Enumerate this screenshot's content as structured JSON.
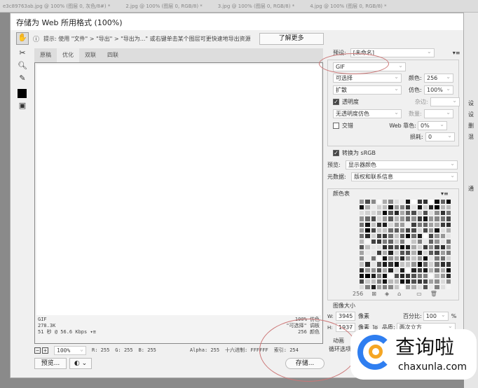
{
  "doc_tabs": [
    "e3c89763ab.jpg @ 100% (图层 0, 灰色/8#) *",
    "2.jpg @ 100% (图层 0, RGB/8) *",
    "3.jpg @ 100% (图层 0, RGB/8) *",
    "4.jpg @ 100% (图层 0, RGB/8) *"
  ],
  "right_bg": [
    "设",
    "设",
    "删",
    "混",
    "通"
  ],
  "dialog": {
    "title": "存储为 Web 所用格式 (100%)",
    "hint": "提示: 使用 \"文件\" > \"导出\" > \"导出为...\" 或右键单击某个图层可更快速地导出资源",
    "learn_more": "了解更多",
    "tabs": [
      "原稿",
      "优化",
      "双联",
      "四联"
    ],
    "info_left": [
      "GIF",
      "278.3K",
      "51 秒 @ 56.6 Kbps"
    ],
    "info_right": [
      "100% 仿色",
      "\"可选择\" 调板",
      "256 颜色"
    ],
    "status": {
      "zoom": "100%",
      "r": "R: 255",
      "g": "G: 255",
      "b": "B: 255",
      "alpha": "Alpha: 255",
      "hex": "十六进制: FFFFFF",
      "index": "索引: 254"
    },
    "preview_button": "预览...",
    "save_button": "存储...",
    "settings": {
      "preset_label": "预设:",
      "preset": "[未命名]",
      "format": "GIF",
      "reduction": "可选择",
      "colors_label": "颜色:",
      "colors": "256",
      "dither_algo": "扩散",
      "dither_label": "仿色:",
      "dither": "100%",
      "transparency": "透明度",
      "matte_label": "杂边:",
      "trans_dither": "无透明度仿色",
      "amount_label": "数量:",
      "interlaced": "交错",
      "websnap_label": "Web 靠色:",
      "websnap": "0%",
      "lossy_label": "损耗:",
      "lossy": "0",
      "convert_srgb": "转换为 sRGB",
      "preview_label": "预览:",
      "preview": "显示器颜色",
      "metadata_label": "元数据:",
      "metadata": "版权和联系信息",
      "color_table_label": "颜色表",
      "color_count": "256",
      "image_size_label": "图像大小",
      "w_label": "W:",
      "w": "3945",
      "h_label": "H:",
      "h": "1937",
      "px": "像素",
      "percent_label": "百分比:",
      "percent": "100",
      "percent_unit": "%",
      "quality_label": "品质:",
      "quality": "两次立方",
      "animation_label": "动画",
      "loop_label": "循环选项"
    }
  },
  "watermark": {
    "cn": "查询啦",
    "en": "chaxunla.com"
  }
}
